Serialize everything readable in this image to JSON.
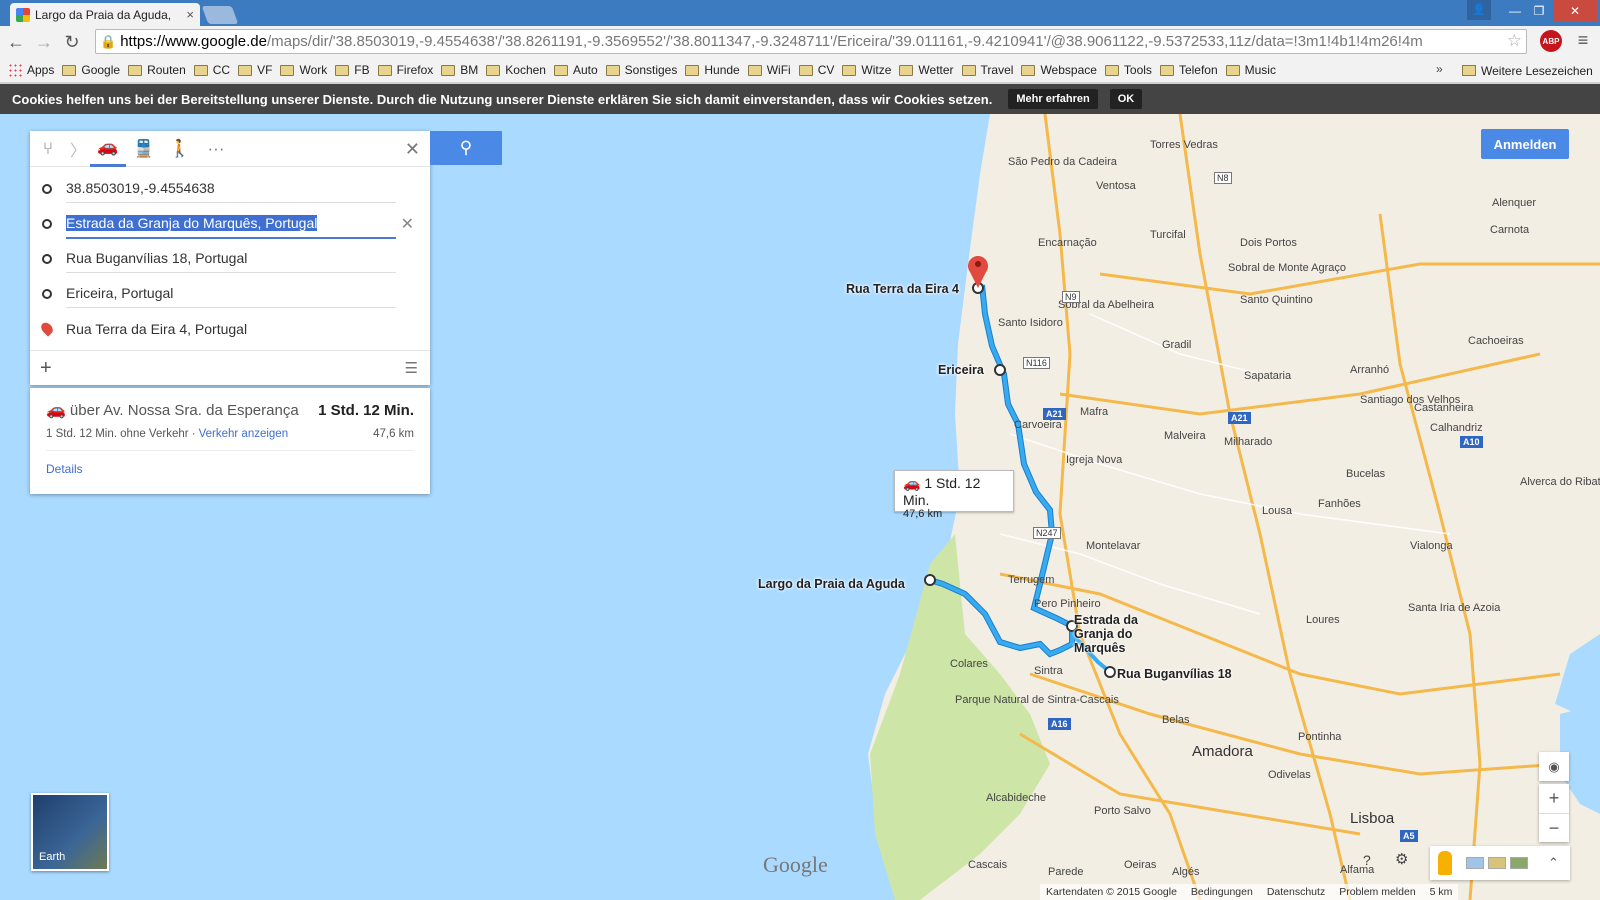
{
  "browser": {
    "tab_title": "Largo da Praia da Aguda,",
    "tab_close": "×",
    "url_host": "https://www.google.de",
    "url_path": "/maps/dir/'38.8503019,-9.4554638'/'38.8261191,-9.3569552'/'38.8011347,-9.3248711'/Ericeira/'39.011161,-9.4210941'/@38.9061122,-9.5372533,11z/data=!3m1!4b1!4m26!4m",
    "abp_label": "ABP",
    "bookmarks": [
      "Apps",
      "Google",
      "Routen",
      "CC",
      "VF",
      "Work",
      "FB",
      "Firefox",
      "BM",
      "Kochen",
      "Auto",
      "Sonstiges",
      "Hunde",
      "WiFi",
      "CV",
      "Witze",
      "Wetter",
      "Travel",
      "Webspace",
      "Tools",
      "Telefon",
      "Music"
    ],
    "bookmarks_more": "»",
    "other_bookmarks": "Weitere Lesezeichen"
  },
  "cookie_bar": {
    "text": "Cookies helfen uns bei der Bereitstellung unserer Dienste. Durch die Nutzung unserer Dienste erklären Sie sich damit einverstanden, dass wir Cookies setzen.",
    "learn_more": "Mehr erfahren",
    "ok": "OK"
  },
  "directions": {
    "waypoints": [
      {
        "text": "38.8503019,-9.4554638"
      },
      {
        "text": "Estrada da Granja do Marquês, Portugal"
      },
      {
        "text": "Rua Buganvílias 18, Portugal"
      },
      {
        "text": "Ericeira, Portugal"
      },
      {
        "text": "Rua Terra da Eira 4, Portugal"
      }
    ],
    "route": {
      "via": "über Av. Nossa Sra. da Esperança",
      "duration": "1 Std. 12 Min.",
      "no_traffic": "1 Std. 12 Min. ohne Verkehr ·",
      "show_traffic": "Verkehr anzeigen",
      "distance": "47,6 km",
      "details": "Details"
    }
  },
  "signin": "Anmelden",
  "earth_label": "Earth",
  "callout": {
    "duration": "1 Std. 12 Min.",
    "distance": "47,6 km"
  },
  "map_labels": {
    "terra_eira": "Rua Terra da Eira 4",
    "ericeira": "Ericeira",
    "aguda": "Largo da Praia da Aguda",
    "granja": "Estrada da Granja do Marquês",
    "buganvilias": "Rua Buganvílias 18"
  },
  "towns": [
    "Torres Vedras",
    "São Pedro da Cadeira",
    "Ventosa",
    "Turcifal",
    "Encarnação",
    "Dois Portos",
    "Sobral de Monte Agraço",
    "Santo Quintino",
    "Alenquer",
    "Carnota",
    "Sobral da Abelheira",
    "Santo Isidoro",
    "Gradil",
    "Sapataria",
    "Arranhó",
    "Castanheira",
    "Cachoeiras",
    "Mafra",
    "Malveira",
    "Milharado",
    "Carvoeira",
    "Igreja Nova",
    "Santiago dos Velhos",
    "Calhandriz",
    "Alverca do Ribatejo",
    "Bucelas",
    "Fanhões",
    "Montelavar",
    "Lousa",
    "Vialonga",
    "Terrugem",
    "Pero Pinheiro",
    "Loures",
    "Santa Iria de Azoia",
    "Colares",
    "Sintra",
    "Parque Natural de Sintra-Cascais",
    "Belas",
    "Pontinha",
    "Odivelas",
    "Amadora",
    "Alcabideche",
    "Porto Salvo",
    "Oeiras",
    "Cascais",
    "Parede",
    "Algés",
    "Lisboa",
    "Alfama"
  ],
  "bottom": {
    "copyright": "Kartendaten © 2015 Google",
    "terms": "Bedingungen",
    "privacy": "Datenschutz",
    "report": "Problem melden",
    "scale": "5 km"
  },
  "google_logo": "Google",
  "colors": {
    "route": "#2fa3e6",
    "accent": "#4a89e6",
    "water": "#aadaff",
    "land": "#f2eee4",
    "park": "#cde6a8"
  }
}
